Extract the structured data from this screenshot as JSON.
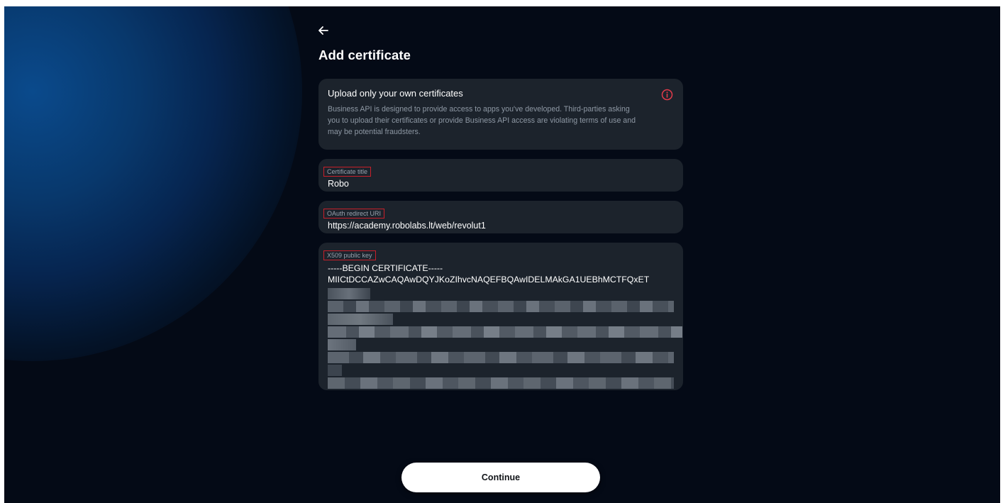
{
  "page": {
    "title": "Add certificate",
    "back_icon": "arrow-left-icon"
  },
  "notice": {
    "title": "Upload only your own certificates",
    "body": "Business API is designed to provide access to apps you've developed. Third-parties asking you to upload their certificates or provide Business API access are violating terms of use and may be potential fraudsters.",
    "icon": "info-icon",
    "icon_color": "#e23b4a"
  },
  "fields": {
    "certificate_title": {
      "label": "Certificate title",
      "value": "Robo"
    },
    "oauth_redirect_uri": {
      "label": "OAuth redirect URI",
      "value": "https://academy.robolabs.lt/web/revolut1"
    },
    "x509_public_key": {
      "label": "X509 public key",
      "lines": [
        "-----BEGIN CERTIFICATE-----",
        "MIICtDCCAZwCAQAwDQYJKoZIhvcNAQEFBQAwIDELMAkGA1UEBhMCTFQxET"
      ]
    }
  },
  "footer": {
    "continue_label": "Continue"
  },
  "colors": {
    "background": "#040a16",
    "card": "#1c232c",
    "accent_glow": "#0a4a8c",
    "highlight_border": "#c8202a"
  }
}
